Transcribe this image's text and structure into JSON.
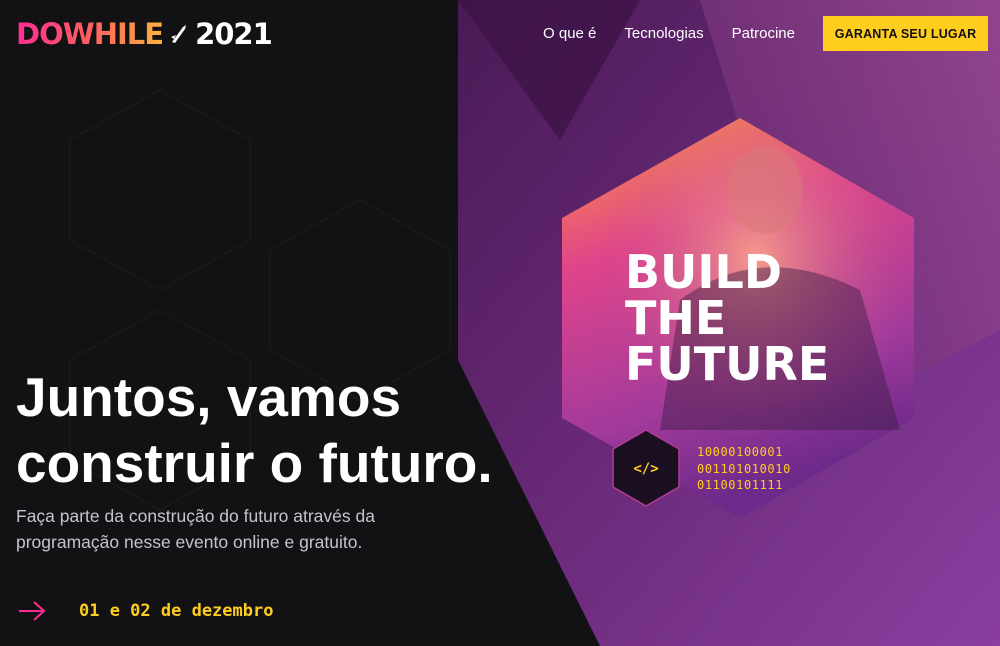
{
  "header": {
    "logo_word": "DOWHILE",
    "logo_year": "2021",
    "nav": [
      "O que é",
      "Tecnologias",
      "Patrocine"
    ],
    "cta_label": "GARANTA SEU LUGAR"
  },
  "hero": {
    "title_line1": "Juntos, vamos",
    "title_line2": "construir o futuro.",
    "subtitle_line1": "Faça parte da construção do futuro através da",
    "subtitle_line2": "programação nesse evento online e gratuito.",
    "date": "01 e 02 de dezembro"
  },
  "art": {
    "headline": [
      "BUILD",
      "THE",
      "FUTURE"
    ],
    "code_symbol": "</>",
    "binary": [
      "10000100001",
      "001101010010",
      "01100101111"
    ]
  },
  "colors": {
    "background": "#121214",
    "accent_yellow": "#ffcd1e",
    "accent_pink": "#ff2d92",
    "purple": "#8257e5"
  }
}
